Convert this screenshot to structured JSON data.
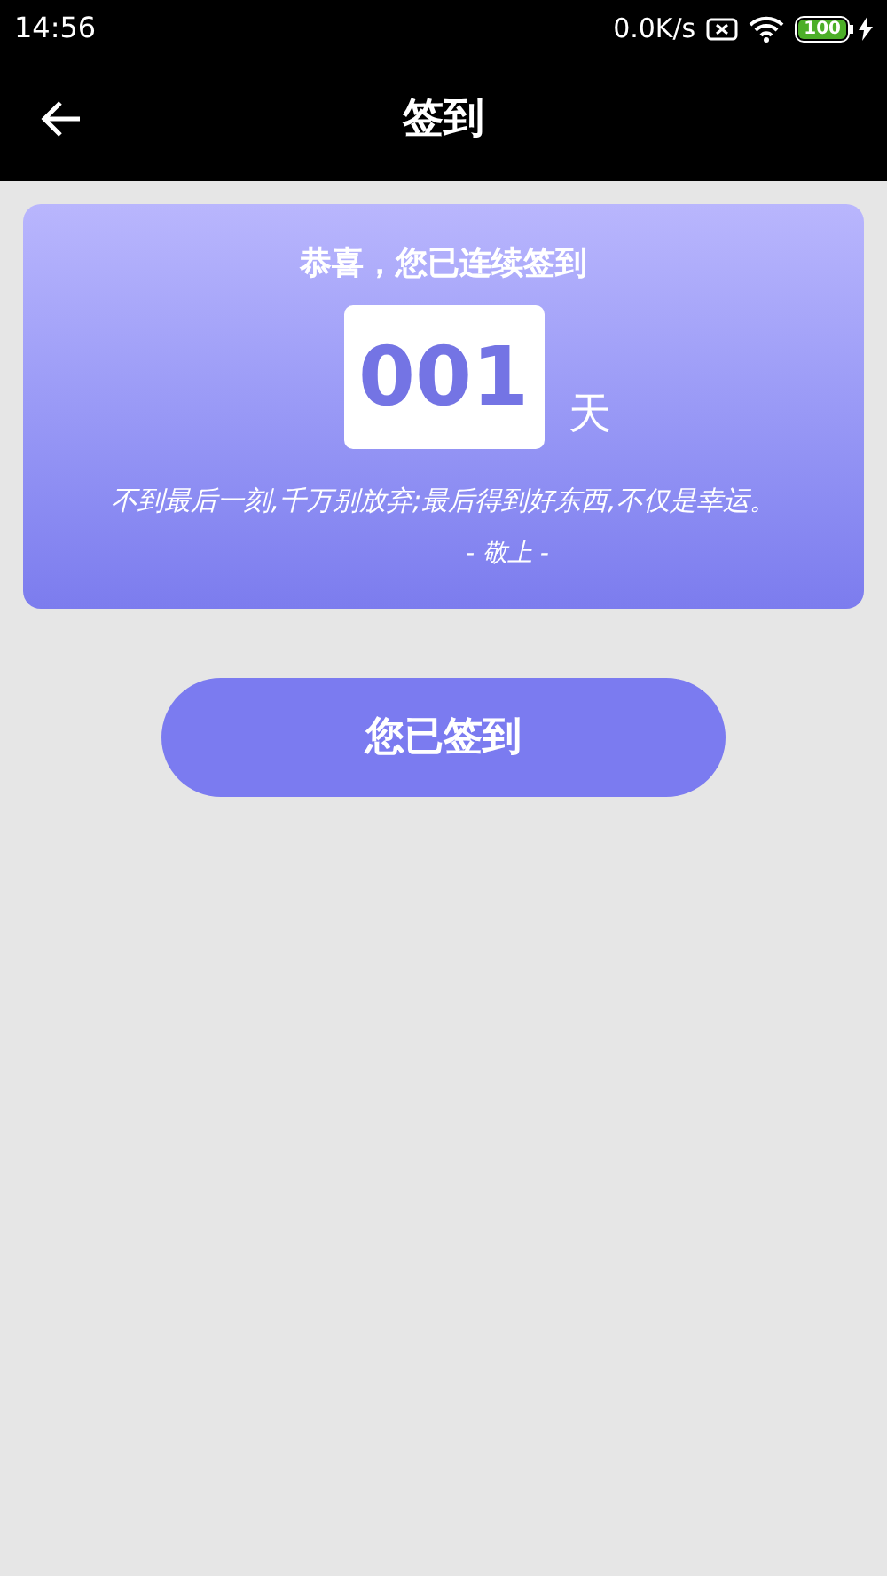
{
  "status_bar": {
    "time": "14:56",
    "net_speed": "0.0K/s",
    "battery": "100"
  },
  "header": {
    "title": "签到"
  },
  "card": {
    "heading": "恭喜，您已连续签到",
    "days": "001",
    "unit": "天",
    "quote": "不到最后一刻,千万别放弃;最后得到好东西,不仅是幸运。",
    "signature": "- 敬上 -"
  },
  "button": {
    "label": "您已签到",
    "disabled": true
  }
}
